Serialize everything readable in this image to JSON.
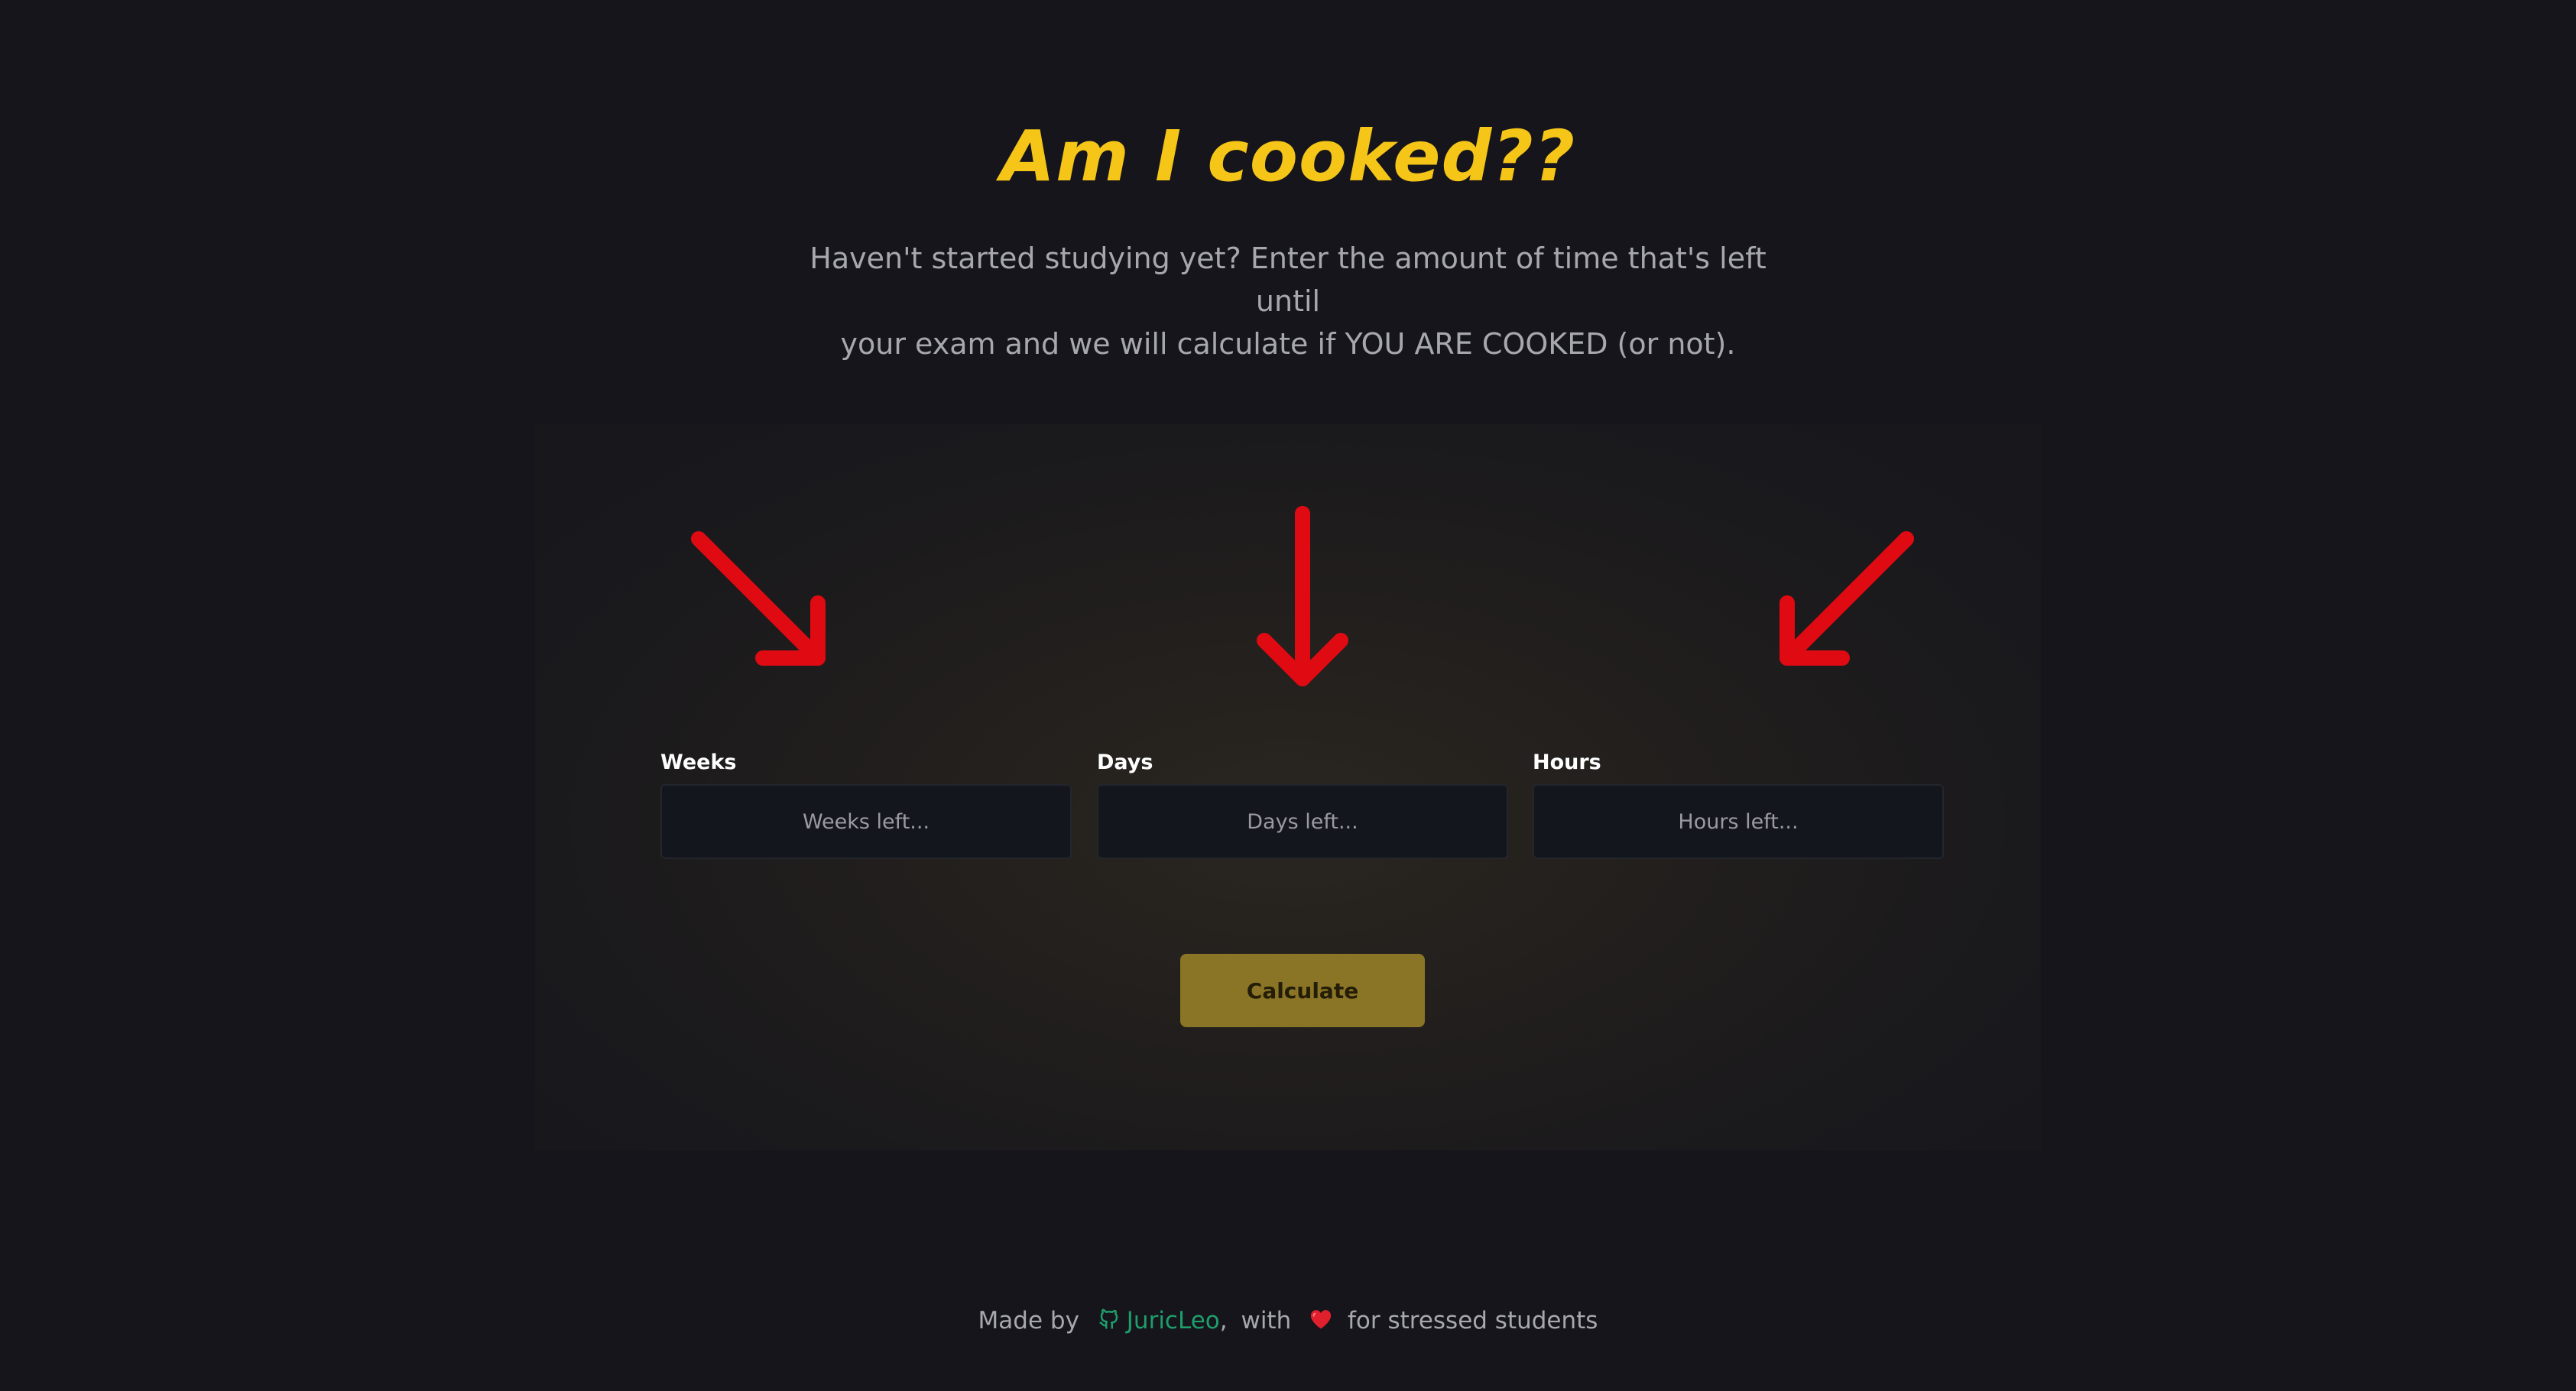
{
  "header": {
    "title": "Am I cooked??",
    "subtitle_line1": "Haven't started studying yet? Enter the amount of time that's left until",
    "subtitle_line2": "your exam and we will calculate if YOU ARE COOKED (or not)."
  },
  "form": {
    "fields": [
      {
        "label": "Weeks",
        "placeholder": "Weeks left...",
        "value": ""
      },
      {
        "label": "Days",
        "placeholder": "Days left...",
        "value": ""
      },
      {
        "label": "Hours",
        "placeholder": "Hours left...",
        "value": ""
      }
    ],
    "calculate_label": "Calculate"
  },
  "footer": {
    "made_by": "Made by",
    "author": "JuricLeo",
    "separator": ",",
    "with": "with",
    "tail": "for stressed students",
    "icons": [
      "github-icon",
      "heart-icon"
    ]
  },
  "colors": {
    "background": "#15151b",
    "title": "#f5c518",
    "subtitle": "#a7a8ad",
    "arrow": "#e00a12",
    "button": "#8a7425",
    "input_bg": "#14161d",
    "link": "#1f9d6a",
    "heart": "#e0202c"
  }
}
